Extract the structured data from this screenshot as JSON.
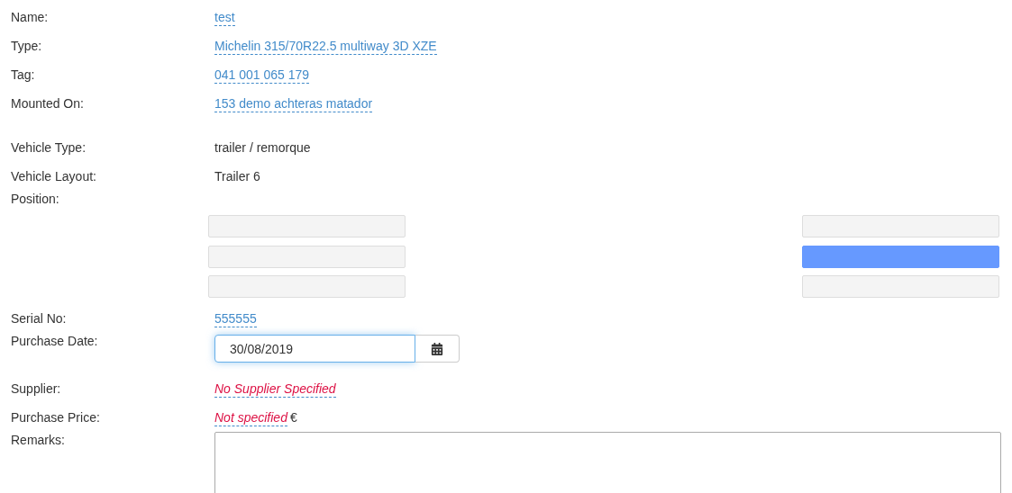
{
  "fields": [
    {
      "label": "Name:",
      "kind": "link",
      "value": "test"
    },
    {
      "label": "Type:",
      "kind": "link",
      "value": "Michelin 315/70R22.5 multiway 3D XZE"
    },
    {
      "label": "Tag:",
      "kind": "link",
      "value": "041 001 065 179"
    },
    {
      "label": "Mounted On:",
      "kind": "link",
      "value": "153 demo achteras matador"
    }
  ],
  "vehicle": [
    {
      "label": "Vehicle Type:",
      "value": "trailer / remorque"
    },
    {
      "label": "Vehicle Layout:",
      "value": "Trailer 6"
    }
  ],
  "position": {
    "label": "Position:",
    "left": [
      {
        "selected": false
      },
      {
        "selected": false
      },
      {
        "selected": false
      }
    ],
    "right": [
      {
        "selected": false
      },
      {
        "selected": true
      },
      {
        "selected": false
      }
    ]
  },
  "serial": {
    "label": "Serial No:",
    "kind": "link",
    "value": "555555"
  },
  "purchase_date": {
    "label": "Purchase Date:",
    "value": "30/08/2019",
    "focused": true
  },
  "purchase": [
    {
      "label": "Supplier:",
      "kind": "empty",
      "value": "No Supplier Specified"
    },
    {
      "label": "Purchase Price:",
      "kind": "empty",
      "value": "Not specified",
      "suffix": "€"
    }
  ],
  "remarks": {
    "label": "Remarks:"
  }
}
